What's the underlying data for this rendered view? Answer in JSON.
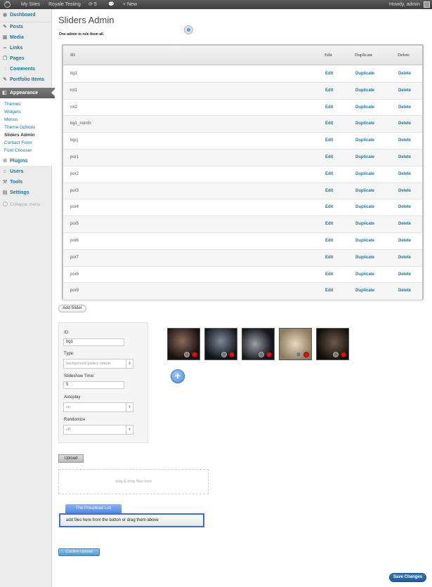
{
  "adminbar": {
    "my_sites": "My Sites",
    "site_name": "Royale Testing",
    "updates_count": "5",
    "new_label": "New",
    "howdy": "Howdy, admin"
  },
  "sidebar": {
    "dashboard": "Dashboard",
    "posts": "Posts",
    "media": "Media",
    "links": "Links",
    "pages": "Pages",
    "comments": "Comments",
    "portfolio": "Portfolio Items",
    "appearance": "Appearance",
    "submenu": [
      "Themes",
      "Widgets",
      "Menus",
      "Theme Options",
      "Sliders Admin",
      "Contact Form",
      "Font Chooser"
    ],
    "plugins": "Plugins",
    "users": "Users",
    "tools": "Tools",
    "settings": "Settings",
    "collapse": "Collapse menu"
  },
  "page": {
    "title": "Sliders Admin",
    "tagline": "One admin to rule them all."
  },
  "table": {
    "headers": {
      "id": "ID",
      "edit": "Edit",
      "duplicate": "Duplicate",
      "delete": "Delete"
    },
    "action_labels": {
      "edit": "Edit",
      "duplicate": "Duplicate",
      "delete": "Delete"
    },
    "rows": [
      "bg1",
      "rol1",
      "rol2",
      "bg1_noinfo",
      "bgcj",
      "por1",
      "por2",
      "por3",
      "por4",
      "por5",
      "por6",
      "por7",
      "por8",
      "por9"
    ]
  },
  "add_slider_label": "Add Slider",
  "form": {
    "id_label": "ID:",
    "id_value": "bg1",
    "type_label": "Type:",
    "type_value": "background gallery simple",
    "slideshow_label": "Slideshow Time:",
    "slideshow_value": "5",
    "autoplay_label": "Autoplay",
    "autoplay_value": "on",
    "randomize_label": "Randomize",
    "randomize_value": "off"
  },
  "add_image_symbol": "+",
  "upload_label": "Upload",
  "dropzone_text": "drag & drop files here",
  "preupload": {
    "tab": "The Preupload List",
    "text": "add files here from the button or drag them above"
  },
  "confirm_upload_label": "Confirm Upload",
  "save_changes_label": "Save Changes",
  "colors": {
    "link": "#21759b",
    "accent_blue": "#4f86e3",
    "delete_red": "#d01818"
  }
}
